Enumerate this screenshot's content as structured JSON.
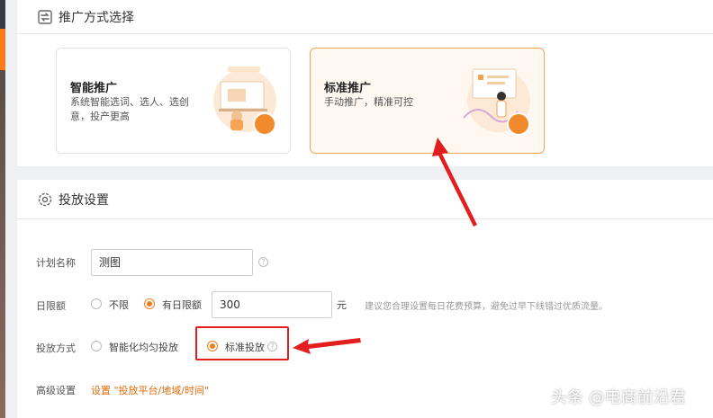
{
  "section1": {
    "title": "推广方式选择",
    "options": [
      {
        "title": "智能推广",
        "desc_line1": "系统智能选词、选人、选创",
        "desc_line2": "意，投产更高"
      },
      {
        "title": "标准推广",
        "desc_line1": "手动推广，精准可控"
      }
    ]
  },
  "section2": {
    "title": "投放设置",
    "plan_name": {
      "label": "计划名称",
      "value": "测图"
    },
    "daily_limit": {
      "label": "日限额",
      "opt_unlimited": "不限",
      "opt_limited": "有日限额",
      "value": "300",
      "unit": "元",
      "hint": "建议您合理设置每日花费预算，避免过早下线错过优质流量。"
    },
    "delivery": {
      "label": "投放方式",
      "opt_smart": "智能化均匀投放",
      "opt_standard": "标准投放"
    },
    "advanced": {
      "label": "高级设置",
      "link": "设置 \"投放平台/地域/时间\""
    }
  },
  "watermark": "头条 @电商前沿君",
  "colors": {
    "accent": "#f07d1c",
    "annotation_red": "#e21e1e",
    "selected_border": "#f5a455"
  }
}
